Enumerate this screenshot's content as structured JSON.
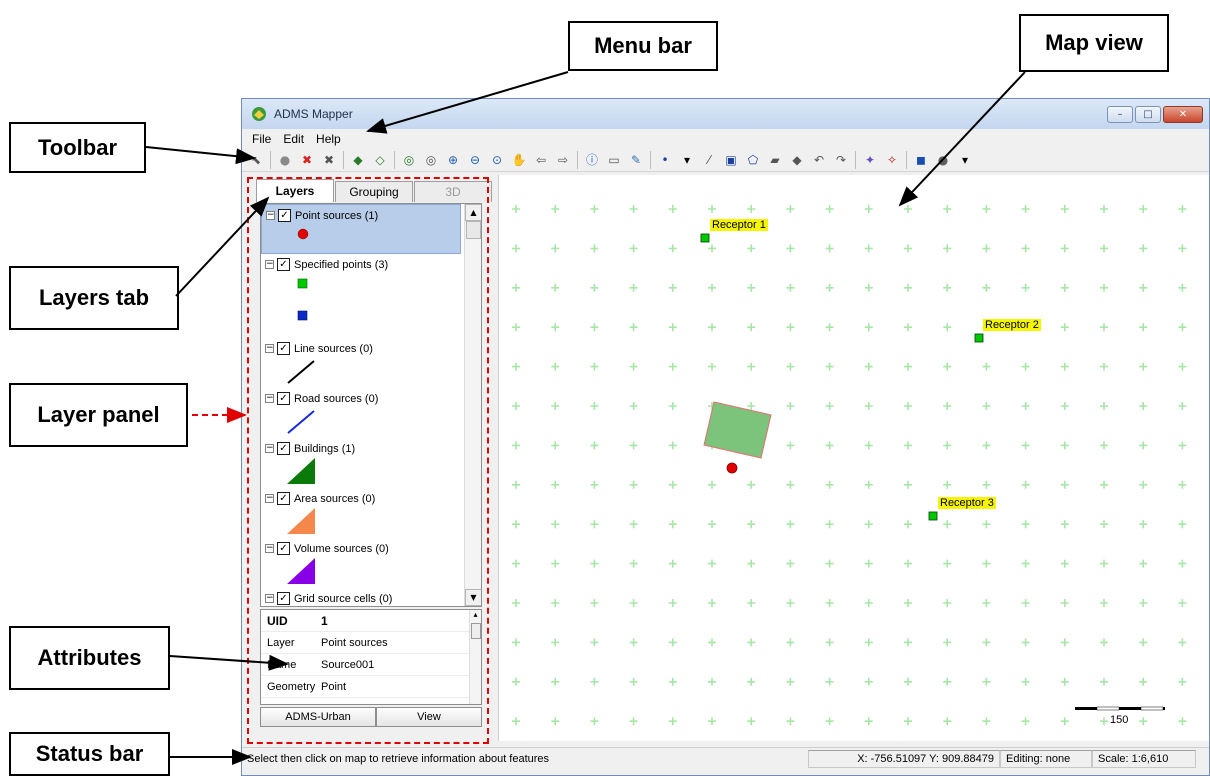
{
  "annotations": {
    "menu_bar": "Menu bar",
    "map_view": "Map view",
    "toolbar": "Toolbar",
    "layers_tab": "Layers tab",
    "layer_panel": "Layer panel",
    "attributes": "Attributes",
    "status_bar": "Status bar"
  },
  "window": {
    "title": "ADMS Mapper",
    "controls": {
      "minimize": "–",
      "maximize": "□",
      "close": "✕"
    }
  },
  "menu": {
    "file": "File",
    "edit": "Edit",
    "help": "Help"
  },
  "toolbar_icons": [
    "select-icon",
    "info-globe-icon",
    "pin-red-icon",
    "pin-gray-icon",
    "add-layer-icon",
    "remove-layer-icon",
    "zoom-extents-icon",
    "zoom-layer-icon",
    "zoom-in-icon",
    "zoom-out-icon",
    "zoom-window-icon",
    "pan-icon",
    "back-icon",
    "forward-icon",
    "info-icon",
    "label-icon",
    "measure-icon",
    "point-icon",
    "dropdown-icon",
    "draw-line-icon",
    "draw-rect-icon",
    "draw-poly-icon",
    "edit-shape-icon",
    "vertex-icon",
    "undo-icon",
    "redo-icon",
    "style-icon",
    "label-style-icon",
    "3d-box-icon",
    "3d-sphere-icon",
    "more-icon"
  ],
  "tabs": {
    "layers": "Layers",
    "grouping": "Grouping",
    "three_d": "3D"
  },
  "layers": [
    {
      "label": "Point sources (1)",
      "swatch": "red-dot",
      "color": "#e30000"
    },
    {
      "label": "Specified points (3)",
      "swatch": "squares",
      "colors": [
        "#00c800",
        "#0a28c8"
      ]
    },
    {
      "label": "Line sources (0)",
      "swatch": "line",
      "color": "#000000"
    },
    {
      "label": "Road sources (0)",
      "swatch": "line",
      "color": "#1428e6"
    },
    {
      "label": "Buildings (1)",
      "swatch": "triangle",
      "color": "#0a7a0a"
    },
    {
      "label": "Area sources (0)",
      "swatch": "triangle",
      "color": "#f5874d"
    },
    {
      "label": "Volume sources (0)",
      "swatch": "triangle",
      "color": "#8a00e6"
    },
    {
      "label": "Grid source cells (0)",
      "swatch": "none"
    }
  ],
  "attributes": {
    "header_key": "UID",
    "header_value": "1",
    "rows": [
      {
        "key": "Layer",
        "value": "Point sources"
      },
      {
        "key": "Name",
        "value": "Source001"
      },
      {
        "key": "Geometry",
        "value": "Point"
      }
    ]
  },
  "panel_buttons": {
    "left": "ADMS-Urban",
    "right": "View"
  },
  "map": {
    "receptors": [
      {
        "label": "Receptor 1"
      },
      {
        "label": "Receptor 2"
      },
      {
        "label": "Receptor 3"
      }
    ],
    "grid_color": "#a8e6a8",
    "building_color": "#7cc47c",
    "scale_bar_label": "150"
  },
  "status": {
    "message": "Select then click on map to retrieve information about features",
    "coords": "X: -756.51097  Y: 909.88479",
    "editing": "Editing: none",
    "scale": "Scale: 1:6,610"
  }
}
